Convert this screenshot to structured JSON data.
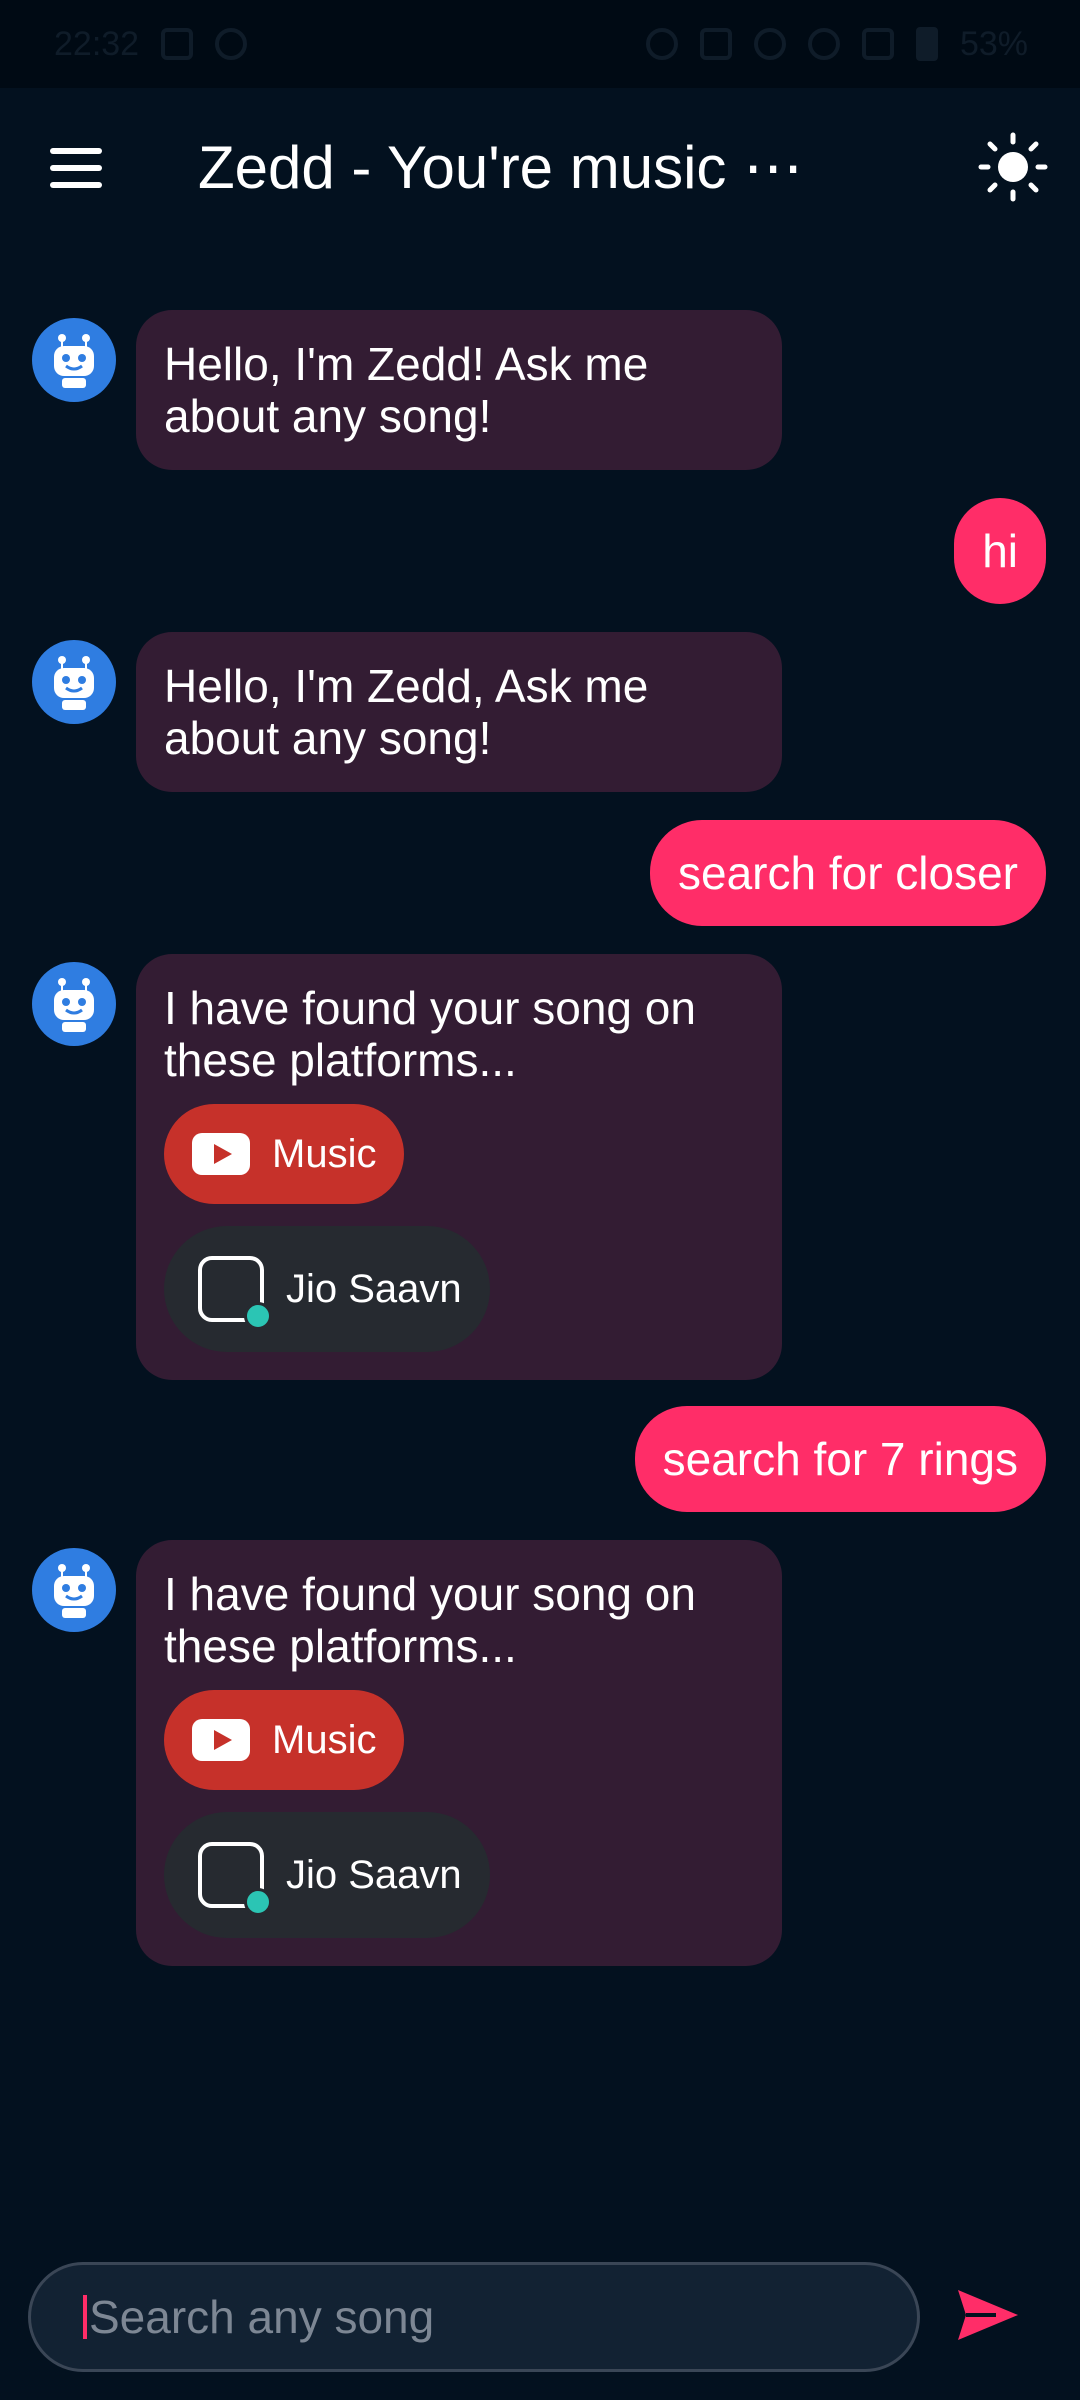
{
  "status_bar": {
    "time": "22:32",
    "battery": "53%"
  },
  "header": {
    "title": "Zedd - You're music ⋯"
  },
  "colors": {
    "background": "#03111f",
    "bot_bubble": "#331c33",
    "user_bubble": "#ff2d68",
    "youtube": "#c6312a",
    "saavn": "#262a30",
    "accent": "#ff2d68"
  },
  "messages": [
    {
      "from": "bot",
      "text": "Hello, I'm Zedd! Ask me about any song!"
    },
    {
      "from": "user",
      "text": "hi"
    },
    {
      "from": "bot",
      "text": "Hello, I'm Zedd, Ask me about any song!"
    },
    {
      "from": "user",
      "text": "search for closer"
    },
    {
      "from": "bot",
      "text": "I have found your song on these platforms...",
      "platforms": [
        "Music",
        "Jio Saavn"
      ]
    },
    {
      "from": "user",
      "text": "search for 7 rings"
    },
    {
      "from": "bot",
      "text": "I have found your song on these platforms...",
      "platforms": [
        "Music",
        "Jio Saavn"
      ]
    }
  ],
  "input": {
    "placeholder": "Search any song",
    "value": ""
  }
}
